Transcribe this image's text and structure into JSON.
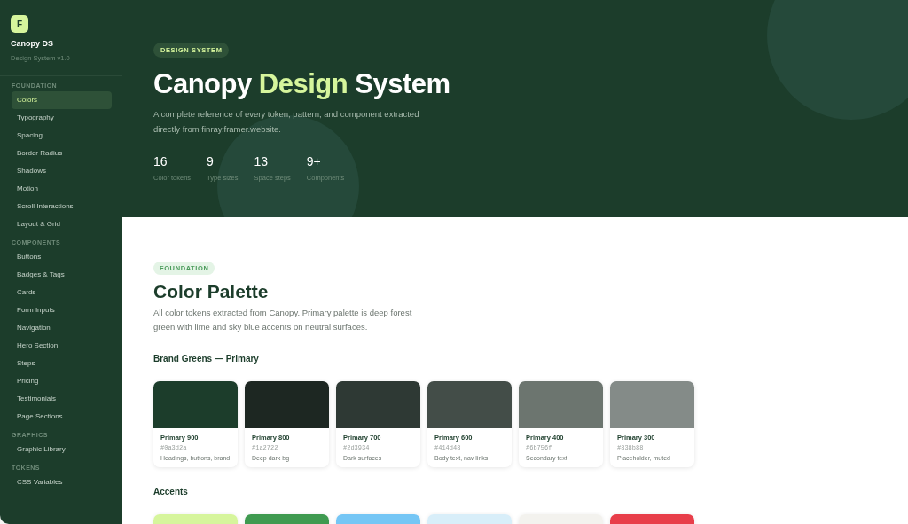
{
  "sidebar": {
    "logo": "F",
    "title": "Canopy DS",
    "subtitle": "Design System v1.0",
    "sections": [
      {
        "label": "FOUNDATION",
        "items": [
          {
            "label": "Colors",
            "selected": true
          },
          {
            "label": "Typography",
            "selected": false
          },
          {
            "label": "Spacing",
            "selected": false
          },
          {
            "label": "Border Radius",
            "selected": false
          },
          {
            "label": "Shadows",
            "selected": false
          },
          {
            "label": "Motion",
            "selected": false
          },
          {
            "label": "Scroll Interactions",
            "selected": false
          },
          {
            "label": "Layout & Grid",
            "selected": false
          }
        ]
      },
      {
        "label": "COMPONENTS",
        "items": [
          {
            "label": "Buttons",
            "selected": false
          },
          {
            "label": "Badges & Tags",
            "selected": false
          },
          {
            "label": "Cards",
            "selected": false
          },
          {
            "label": "Form Inputs",
            "selected": false
          },
          {
            "label": "Navigation",
            "selected": false
          },
          {
            "label": "Hero Section",
            "selected": false
          },
          {
            "label": "Steps",
            "selected": false
          },
          {
            "label": "Pricing",
            "selected": false
          },
          {
            "label": "Testimonials",
            "selected": false
          },
          {
            "label": "Page Sections",
            "selected": false
          }
        ]
      },
      {
        "label": "GRAPHICS",
        "items": [
          {
            "label": "Graphic Library",
            "selected": false
          }
        ]
      },
      {
        "label": "TOKENS",
        "items": [
          {
            "label": "CSS Variables",
            "selected": false
          }
        ]
      }
    ]
  },
  "hero": {
    "badge": "DESIGN SYSTEM",
    "title": "Canopy **Design** System",
    "description": "A complete reference of every token, pattern, and component extracted directly from finray.framer.website.",
    "stats": [
      {
        "value": "16",
        "label": "Color tokens"
      },
      {
        "value": "9",
        "label": "Type sizes"
      },
      {
        "value": "13",
        "label": "Space steps"
      },
      {
        "value": "9+",
        "label": "Components"
      }
    ]
  },
  "section": {
    "badge": "FOUNDATION",
    "title": "Color Palette",
    "description": "All color tokens extracted from Canopy. Primary palette is deep forest green with lime and sky blue accents on neutral surfaces.",
    "groups": [
      {
        "title": "Brand Greens — Primary",
        "swatches": [
          {
            "name": "Primary 900",
            "hex": "#0a3d2a",
            "usage": "Headings, buttons, brand",
            "color": "#1c3d2b"
          },
          {
            "name": "Primary 800",
            "hex": "#1a2722",
            "usage": "Deep dark bg",
            "color": "#1d2722"
          },
          {
            "name": "Primary 700",
            "hex": "#2d3934",
            "usage": "Dark surfaces",
            "color": "#2e3934"
          },
          {
            "name": "Primary 600",
            "hex": "#414d48",
            "usage": "Body text, nav links",
            "color": "#434d48"
          },
          {
            "name": "Primary 400",
            "hex": "#6b756f",
            "usage": "Secondary text",
            "color": "#6c756f"
          },
          {
            "name": "Primary 300",
            "hex": "#838b88",
            "usage": "Placeholder, muted",
            "color": "#848b88"
          }
        ]
      },
      {
        "title": "Accents",
        "swatches": [
          {
            "color": "#d6f59c"
          },
          {
            "color": "#3f9a50"
          },
          {
            "color": "#75c6f5"
          },
          {
            "color": "#d8eef9"
          },
          {
            "color": "#f3f2ee"
          },
          {
            "color": "#e83e4a"
          }
        ]
      }
    ]
  }
}
